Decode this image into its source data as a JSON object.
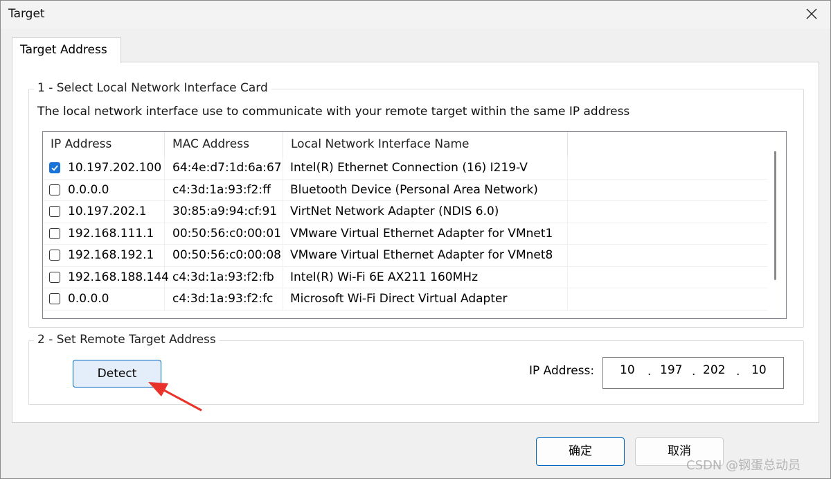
{
  "window": {
    "title": "Target"
  },
  "tabs": [
    {
      "label": "Target Address",
      "active": true
    }
  ],
  "section1": {
    "legend": "1 - Select Local Network Interface Card",
    "description": "The local network interface use to communicate with your remote target within the same IP address",
    "columns": [
      "IP Address",
      "MAC Address",
      "Local Network Interface Name"
    ],
    "rows": [
      {
        "checked": true,
        "ip": "10.197.202.100",
        "mac": "64:4e:d7:1d:6a:67",
        "name": "Intel(R) Ethernet Connection (16) I219-V"
      },
      {
        "checked": false,
        "ip": "0.0.0.0",
        "mac": "c4:3d:1a:93:f2:ff",
        "name": "Bluetooth Device (Personal Area Network)"
      },
      {
        "checked": false,
        "ip": "10.197.202.1",
        "mac": "30:85:a9:94:cf:91",
        "name": "VirtNet Network Adapter (NDIS 6.0)"
      },
      {
        "checked": false,
        "ip": "192.168.111.1",
        "mac": "00:50:56:c0:00:01",
        "name": "VMware Virtual Ethernet Adapter for VMnet1"
      },
      {
        "checked": false,
        "ip": "192.168.192.1",
        "mac": "00:50:56:c0:00:08",
        "name": "VMware Virtual Ethernet Adapter for VMnet8"
      },
      {
        "checked": false,
        "ip": "192.168.188.144",
        "mac": "c4:3d:1a:93:f2:fb",
        "name": "Intel(R) Wi-Fi 6E AX211 160MHz"
      },
      {
        "checked": false,
        "ip": "0.0.0.0",
        "mac": "c4:3d:1a:93:f2:fc",
        "name": "Microsoft Wi-Fi Direct Virtual Adapter"
      }
    ]
  },
  "section2": {
    "legend": "2 - Set Remote Target Address",
    "detect_label": "Detect",
    "ip_label": "IP Address:",
    "ip_octets": [
      "10",
      "197",
      "202",
      "10"
    ]
  },
  "footer": {
    "ok_label": "确定",
    "cancel_label": "取消"
  },
  "watermark": "CSDN @钢蛋总动员",
  "colors": {
    "accent": "#0067c0",
    "check": "#1a73d9",
    "arrow": "#e8332a"
  }
}
